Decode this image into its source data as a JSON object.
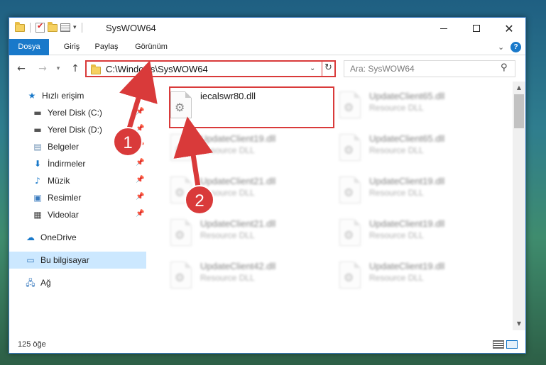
{
  "window": {
    "title": "SysWOW64",
    "qat_dropdown": "▾"
  },
  "ribbon": {
    "tabs": [
      {
        "label": "Dosya"
      },
      {
        "label": "Giriş"
      },
      {
        "label": "Paylaş"
      },
      {
        "label": "Görünüm"
      }
    ],
    "help": "?"
  },
  "address": {
    "path": "C:\\Windows\\SysWOW64",
    "search_placeholder": "Ara: SysWOW64"
  },
  "sidebar": {
    "items": [
      {
        "label": "Hızlı erişim",
        "icon": "star-icon",
        "pinned": false
      },
      {
        "label": "Yerel Disk (C:)",
        "icon": "drive-icon",
        "pinned": true
      },
      {
        "label": "Yerel Disk (D:)",
        "icon": "drive-icon",
        "pinned": true
      },
      {
        "label": "Belgeler",
        "icon": "document-icon",
        "pinned": true
      },
      {
        "label": "İndirmeler",
        "icon": "download-icon",
        "pinned": true
      },
      {
        "label": "Müzik",
        "icon": "music-icon",
        "pinned": true
      },
      {
        "label": "Resimler",
        "icon": "pictures-icon",
        "pinned": true
      },
      {
        "label": "Videolar",
        "icon": "video-icon",
        "pinned": true
      },
      {
        "label": "OneDrive",
        "icon": "cloud-icon",
        "pinned": false
      },
      {
        "label": "Bu bilgisayar",
        "icon": "computer-icon",
        "pinned": false,
        "selected": true
      },
      {
        "label": "Ağ",
        "icon": "network-icon",
        "pinned": false
      }
    ]
  },
  "files": [
    {
      "name": "iecalswr80.dll",
      "type": "",
      "highlighted": true
    },
    {
      "name": "UpdateClient65.dll",
      "type": "Resource DLL"
    },
    {
      "name": "UpdateClient19.dll",
      "type": "Resource DLL"
    },
    {
      "name": "UpdateClient65.dll",
      "type": "Resource DLL"
    },
    {
      "name": "UpdateClient21.dll",
      "type": "Resource DLL"
    },
    {
      "name": "UpdateClient19.dll",
      "type": "Resource DLL"
    },
    {
      "name": "UpdateClient21.dll",
      "type": "Resource DLL"
    },
    {
      "name": "UpdateClient19.dll",
      "type": "Resource DLL"
    },
    {
      "name": "UpdateClient42.dll",
      "type": "Resource DLL"
    },
    {
      "name": "UpdateClient19.dll",
      "type": "Resource DLL"
    }
  ],
  "status": {
    "item_count": "125 öğe"
  },
  "annotations": {
    "step1": "1",
    "step2": "2",
    "color": "#d93a3a"
  }
}
